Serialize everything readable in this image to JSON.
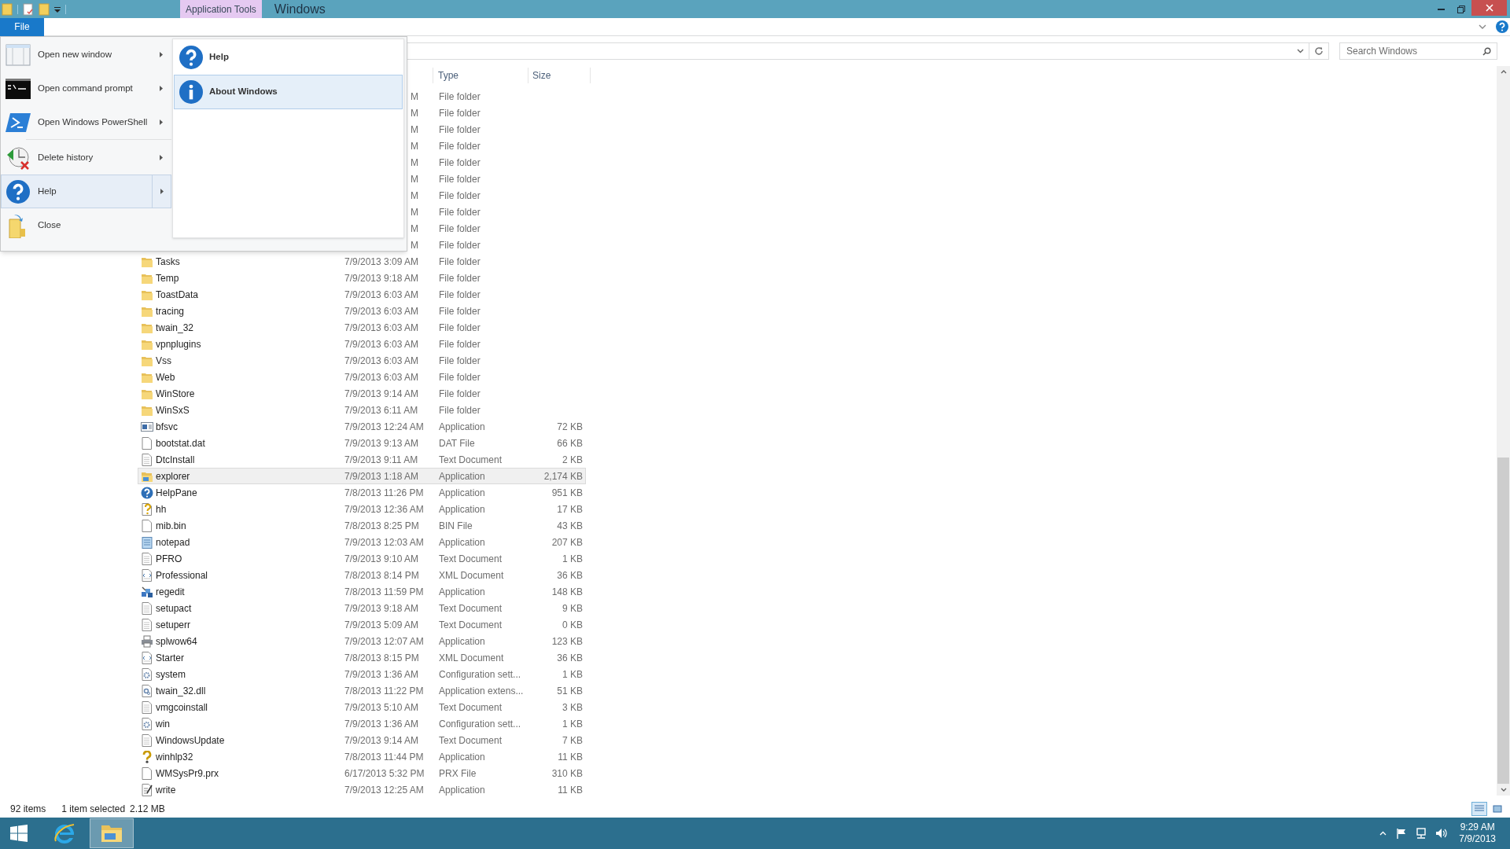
{
  "window": {
    "title": "Windows",
    "context_tab": "Application Tools"
  },
  "ribbon": {
    "file_tab": "File"
  },
  "file_menu": [
    {
      "label": "Open new window",
      "kind": "window",
      "has_submenu": true,
      "selected": false
    },
    {
      "label": "Open command prompt",
      "kind": "cmd",
      "has_submenu": true,
      "selected": false
    },
    {
      "label": "Open Windows PowerShell",
      "kind": "powershell",
      "has_submenu": true,
      "selected": false
    },
    {
      "label": "Delete history",
      "kind": "history",
      "has_submenu": true,
      "selected": false
    },
    {
      "label": "Help",
      "kind": "help",
      "has_submenu": true,
      "selected": true
    },
    {
      "label": "Close",
      "kind": "close",
      "has_submenu": false,
      "selected": false
    }
  ],
  "submenu": [
    {
      "label": "Help",
      "kind": "help",
      "selected": false
    },
    {
      "label": "About Windows",
      "kind": "info",
      "selected": true
    }
  ],
  "search": {
    "placeholder": "Search Windows"
  },
  "columns": [
    "Type",
    "Size"
  ],
  "rows": [
    {
      "date": "M",
      "type": "File folder"
    },
    {
      "date": "M",
      "type": "File folder"
    },
    {
      "date": "M",
      "type": "File folder"
    },
    {
      "date": "M",
      "type": "File folder"
    },
    {
      "date": "M",
      "type": "File folder"
    },
    {
      "date": "M",
      "type": "File folder"
    },
    {
      "date": "M",
      "type": "File folder"
    },
    {
      "date": "M",
      "type": "File folder"
    },
    {
      "date": "M",
      "type": "File folder"
    },
    {
      "date": "M",
      "type": "File folder"
    },
    {
      "name": "Tasks",
      "kind": "folder",
      "date": "7/9/2013 3:09 AM",
      "type": "File folder",
      "selected": false
    },
    {
      "name": "Temp",
      "kind": "folder",
      "date": "7/9/2013 9:18 AM",
      "type": "File folder",
      "selected": false
    },
    {
      "name": "ToastData",
      "kind": "folder",
      "date": "7/9/2013 6:03 AM",
      "type": "File folder",
      "selected": false
    },
    {
      "name": "tracing",
      "kind": "folder",
      "date": "7/9/2013 6:03 AM",
      "type": "File folder",
      "selected": false
    },
    {
      "name": "twain_32",
      "kind": "folder",
      "date": "7/9/2013 6:03 AM",
      "type": "File folder",
      "selected": false
    },
    {
      "name": "vpnplugins",
      "kind": "folder",
      "date": "7/9/2013 6:03 AM",
      "type": "File folder",
      "selected": false
    },
    {
      "name": "Vss",
      "kind": "folder",
      "date": "7/9/2013 6:03 AM",
      "type": "File folder",
      "selected": false
    },
    {
      "name": "Web",
      "kind": "folder",
      "date": "7/9/2013 6:03 AM",
      "type": "File folder",
      "selected": false
    },
    {
      "name": "WinStore",
      "kind": "folder",
      "date": "7/9/2013 9:14 AM",
      "type": "File folder",
      "selected": false
    },
    {
      "name": "WinSxS",
      "kind": "folder",
      "date": "7/9/2013 6:11 AM",
      "type": "File folder",
      "selected": false
    },
    {
      "name": "bfsvc",
      "kind": "app",
      "date": "7/9/2013 12:24 AM",
      "type": "Application",
      "size": "72 KB",
      "selected": false
    },
    {
      "name": "bootstat.dat",
      "kind": "blank",
      "date": "7/9/2013 9:13 AM",
      "type": "DAT File",
      "size": "66 KB",
      "selected": false
    },
    {
      "name": "DtcInstall",
      "kind": "text",
      "date": "7/9/2013 9:11 AM",
      "type": "Text Document",
      "size": "2 KB",
      "selected": false
    },
    {
      "name": "explorer",
      "kind": "explorer",
      "date": "7/9/2013 1:18 AM",
      "type": "Application",
      "size": "2,174 KB",
      "selected": true
    },
    {
      "name": "HelpPane",
      "kind": "help",
      "date": "7/8/2013 11:26 PM",
      "type": "Application",
      "size": "951 KB",
      "selected": false
    },
    {
      "name": "hh",
      "kind": "hh",
      "date": "7/9/2013 12:36 AM",
      "type": "Application",
      "size": "17 KB",
      "selected": false
    },
    {
      "name": "mib.bin",
      "kind": "blank",
      "date": "7/8/2013 8:25 PM",
      "type": "BIN File",
      "size": "43 KB",
      "selected": false
    },
    {
      "name": "notepad",
      "kind": "notepad",
      "date": "7/9/2013 12:03 AM",
      "type": "Application",
      "size": "207 KB",
      "selected": false
    },
    {
      "name": "PFRO",
      "kind": "text",
      "date": "7/9/2013 9:10 AM",
      "type": "Text Document",
      "size": "1 KB",
      "selected": false
    },
    {
      "name": "Professional",
      "kind": "xml",
      "date": "7/8/2013 8:14 PM",
      "type": "XML Document",
      "size": "36 KB",
      "selected": false
    },
    {
      "name": "regedit",
      "kind": "regedit",
      "date": "7/8/2013 11:59 PM",
      "type": "Application",
      "size": "148 KB",
      "selected": false
    },
    {
      "name": "setupact",
      "kind": "text",
      "date": "7/9/2013 9:18 AM",
      "type": "Text Document",
      "size": "9 KB",
      "selected": false
    },
    {
      "name": "setuperr",
      "kind": "text",
      "date": "7/9/2013 5:09 AM",
      "type": "Text Document",
      "size": "0 KB",
      "selected": false
    },
    {
      "name": "splwow64",
      "kind": "printer",
      "date": "7/9/2013 12:07 AM",
      "type": "Application",
      "size": "123 KB",
      "selected": false
    },
    {
      "name": "Starter",
      "kind": "xml",
      "date": "7/8/2013 8:15 PM",
      "type": "XML Document",
      "size": "36 KB",
      "selected": false
    },
    {
      "name": "system",
      "kind": "config",
      "date": "7/9/2013 1:36 AM",
      "type": "Configuration sett...",
      "size": "1 KB",
      "selected": false
    },
    {
      "name": "twain_32.dll",
      "kind": "dll",
      "date": "7/8/2013 11:22 PM",
      "type": "Application extens...",
      "size": "51 KB",
      "selected": false
    },
    {
      "name": "vmgcoinstall",
      "kind": "text",
      "date": "7/9/2013 5:10 AM",
      "type": "Text Document",
      "size": "3 KB",
      "selected": false
    },
    {
      "name": "win",
      "kind": "config",
      "date": "7/9/2013 1:36 AM",
      "type": "Configuration sett...",
      "size": "1 KB",
      "selected": false
    },
    {
      "name": "WindowsUpdate",
      "kind": "text",
      "date": "7/9/2013 9:14 AM",
      "type": "Text Document",
      "size": "7 KB",
      "selected": false
    },
    {
      "name": "winhlp32",
      "kind": "winhlp",
      "date": "7/8/2013 11:44 PM",
      "type": "Application",
      "size": "11 KB",
      "selected": false
    },
    {
      "name": "WMSysPr9.prx",
      "kind": "blank",
      "date": "6/17/2013 5:32 PM",
      "type": "PRX File",
      "size": "310 KB",
      "selected": false
    },
    {
      "name": "write",
      "kind": "write",
      "date": "7/9/2013 12:25 AM",
      "type": "Application",
      "size": "11 KB",
      "selected": false
    }
  ],
  "status_bar": {
    "item_count": "92 items",
    "selection": "1 item selected",
    "selection_size": "2.12 MB"
  },
  "taskbar": {
    "apps": [
      {
        "kind": "ie",
        "active": false
      },
      {
        "kind": "explorer",
        "active": true
      }
    ],
    "clock_time": "9:29 AM",
    "clock_date": "7/9/2013"
  }
}
